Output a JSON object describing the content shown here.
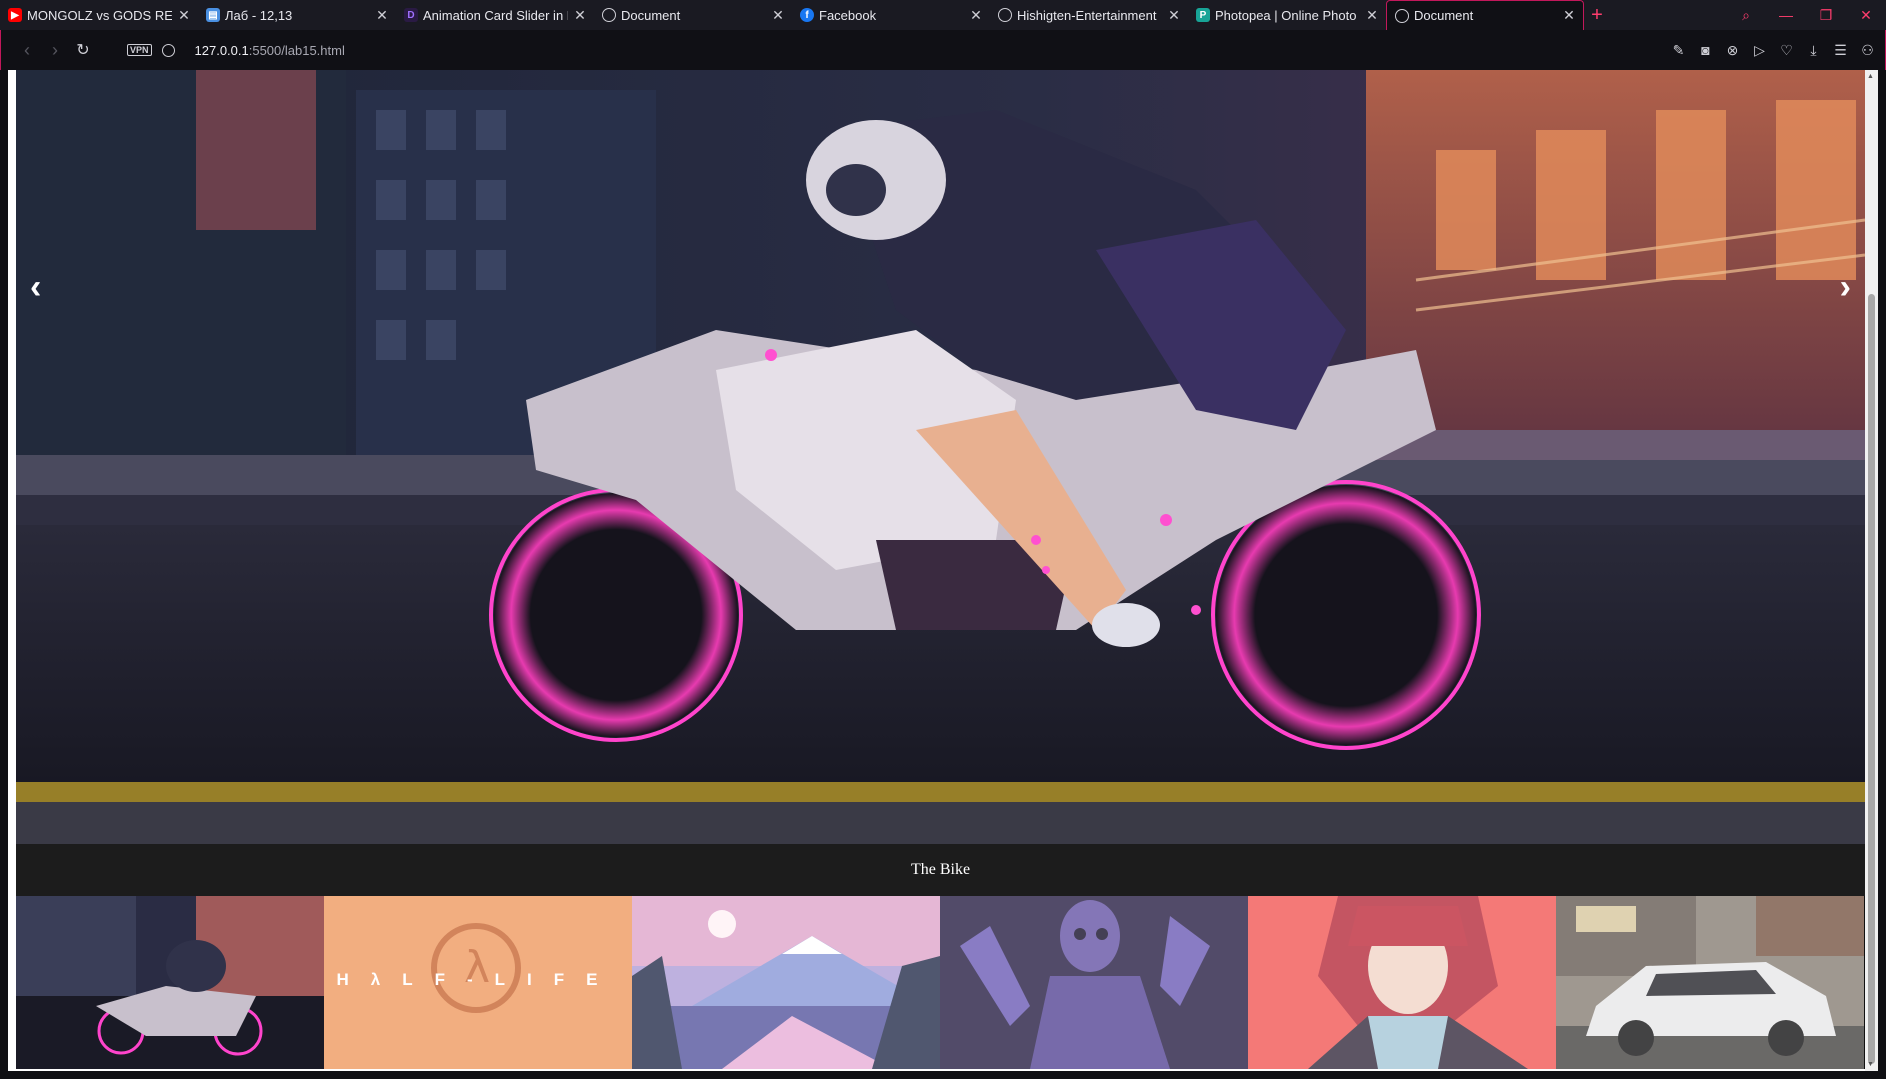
{
  "browser": {
    "tabs": [
      {
        "title": "MONGOLZ vs GODS REIGN",
        "favicon": "youtube-icon",
        "color": "#ff0000"
      },
      {
        "title": "Лаб - 12,13",
        "favicon": "document-icon",
        "color": "#4a90e2"
      },
      {
        "title": "Animation Card Slider in H",
        "favicon": "devto-icon",
        "color": "#6c2bd9"
      },
      {
        "title": "Document",
        "favicon": "globe-icon",
        "color": "#cfcfd6"
      },
      {
        "title": "Facebook",
        "favicon": "facebook-icon",
        "color": "#1877f2"
      },
      {
        "title": "Hishigten-Entertainment",
        "favicon": "globe-icon",
        "color": "#cfcfd6"
      },
      {
        "title": "Photopea | Online Photo E",
        "favicon": "photopea-icon",
        "color": "#18a497"
      },
      {
        "title": "Document",
        "favicon": "globe-icon",
        "color": "#cfcfd6",
        "active": true
      }
    ],
    "url_host": "127.0.0.1",
    "url_rest": ":5500/lab15.html",
    "vpn_label": "VPN",
    "accent_color": "#c2185b"
  },
  "gallery": {
    "caption": "The Bike",
    "prev_glyph": "‹",
    "next_glyph": "›",
    "thumbnails": [
      {
        "name": "motorbike-rider",
        "active": true
      },
      {
        "name": "half-life",
        "text": "HλLF-LIFE"
      },
      {
        "name": "mountain-lake-sunset"
      },
      {
        "name": "purple-reaper"
      },
      {
        "name": "red-haired-anime-character"
      },
      {
        "name": "white-sports-car"
      }
    ]
  }
}
